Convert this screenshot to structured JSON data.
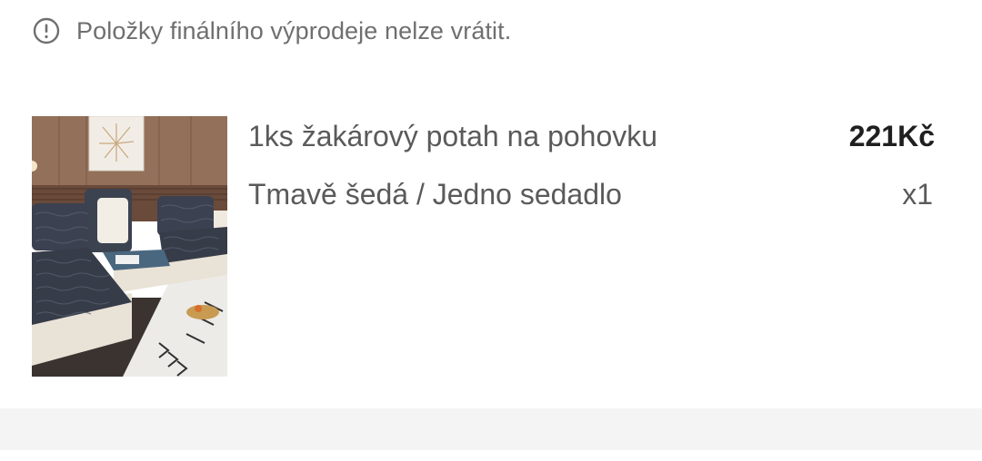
{
  "notice": {
    "icon": "exclamation-circle-icon",
    "text": "Položky finálního výprodeje nelze vrátit."
  },
  "item": {
    "image_icon": "sofa-cover-product-image",
    "title": "1ks žakárový potah na pohovku",
    "price": "221Kč",
    "variant": "Tmavě šedá / Jedno sedadlo",
    "quantity": "x1"
  },
  "colors": {
    "text_secondary": "#5a5a5a",
    "text_primary": "#1f1f1f",
    "notice_gray": "#6f6f6f",
    "band_gray": "#f4f4f4"
  }
}
